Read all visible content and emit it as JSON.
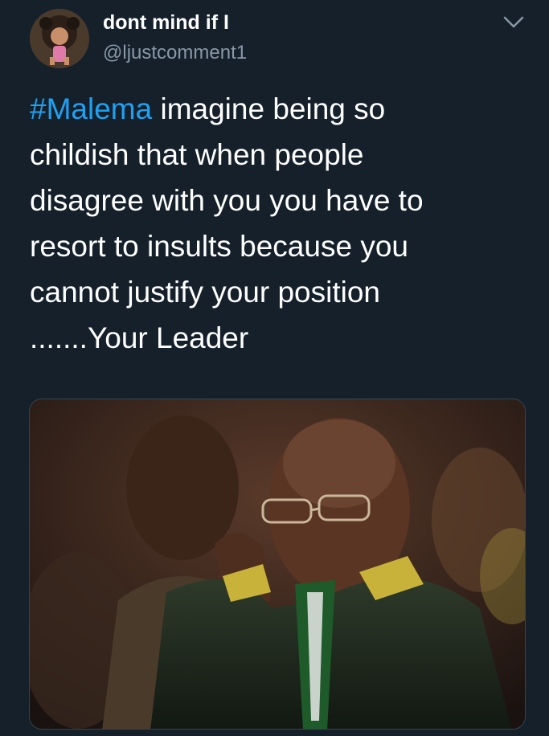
{
  "tweet": {
    "display_name": "dont mind if I",
    "handle": "@ljustcomment1",
    "hashtag": "#Malema",
    "text_lines": [
      " imagine being so",
      "childish that when people",
      "disagree with you you have to",
      "resort to insults because you",
      "cannot justify your position",
      ".......Your Leader"
    ]
  },
  "icons": {
    "menu": "chevron-down-icon",
    "avatar": "avatar-image",
    "media": "photo-two-men-seated"
  },
  "colors": {
    "background": "#15202b",
    "text": "#ffffff",
    "secondary_text": "#8899a6",
    "link": "#1da1f2"
  }
}
